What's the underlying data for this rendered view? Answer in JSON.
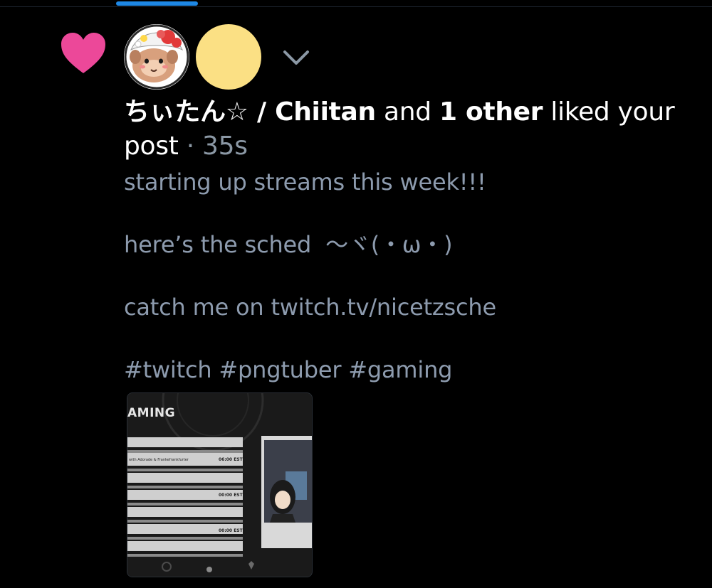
{
  "colors": {
    "background": "#000000",
    "heart": "#ec4899",
    "accent_tab": "#1e88e5",
    "muted_text": "#8d9bae",
    "avatar2": "#fbe084"
  },
  "notification": {
    "icon": "heart-icon",
    "actor_name": "ちぃたん☆ / Chiitan",
    "conjunction": "and",
    "others": "1 other",
    "action": "liked your post",
    "separator": "·",
    "timestamp": "35s",
    "expand_icon": "chevron-down-icon"
  },
  "post": {
    "line1": "starting up streams this week!!!",
    "line2": "here’s the sched  ～ヾ(・ω・)",
    "line3": "catch me on twitch.tv/nicetzsche",
    "line4": "#twitch #pngtuber #gaming"
  },
  "thumbnail": {
    "title": "AMING",
    "row1": "with Adorade & Frankefrankfurter",
    "time1": "06:00 EST",
    "time2": "00:00 EST",
    "time3": "00:00 EST"
  }
}
